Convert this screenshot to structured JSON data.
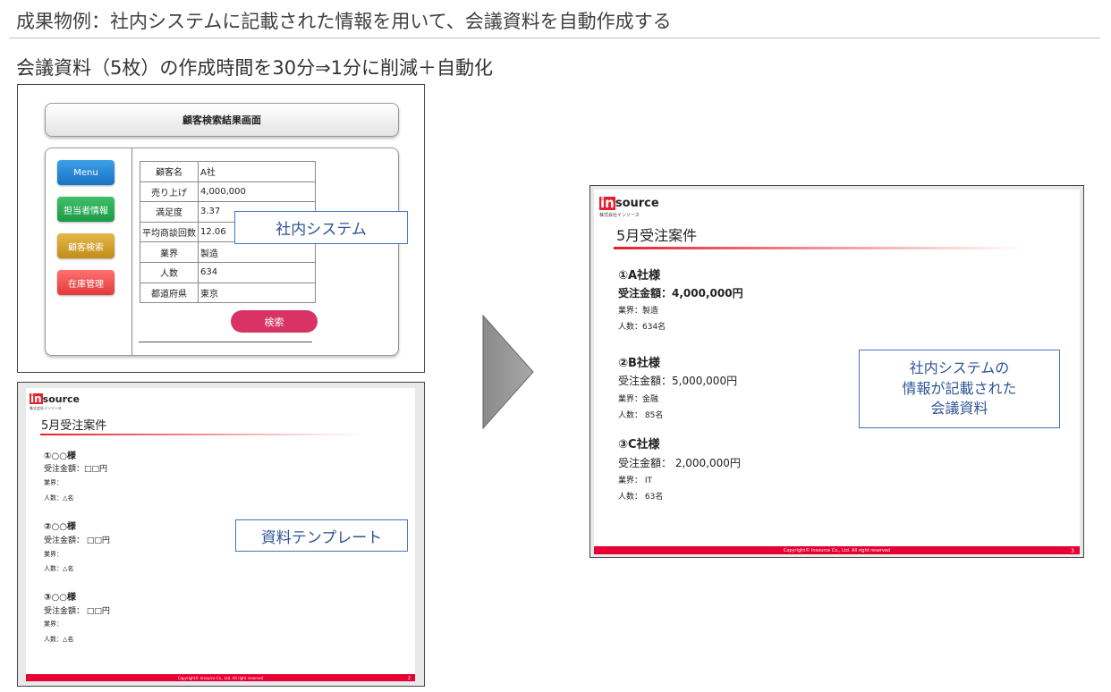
{
  "header": {
    "title": "成果物例：社内システムに記載された情報を用いて、会議資料を自動作成する",
    "subtitle": "会議資料（5枚）の作成時間を30分⇒1分に削減＋自動化"
  },
  "system": {
    "screen_title": "顧客検索結果画面",
    "menu": [
      "Menu",
      "担当者情報",
      "顧客検索",
      "在庫管理"
    ],
    "rows": [
      {
        "label": "顧客名",
        "value": "A社"
      },
      {
        "label": "売り上げ",
        "value": "4,000,000"
      },
      {
        "label": "満足度",
        "value": "3.37"
      },
      {
        "label": "平均商談回数",
        "value": "12.06"
      },
      {
        "label": "業界",
        "value": "製造"
      },
      {
        "label": "人数",
        "value": "634"
      },
      {
        "label": "都道府県",
        "value": "東京"
      }
    ],
    "search_label": "検索",
    "callout": "社内システム"
  },
  "template_slide": {
    "logo_in": "in",
    "logo_source": "source",
    "logo_sub": "株式会社インソース",
    "heading": "5月受注案件",
    "items": [
      {
        "name": "①○○様",
        "amount": "受注金額：□□円",
        "industry": "業界：",
        "people": "人数：△名"
      },
      {
        "name": "②○○様",
        "amount": "受注金額： □□円",
        "industry": "業界：",
        "people": "人数：△名"
      },
      {
        "name": "③○○様",
        "amount": "受注金額： □□円",
        "industry": "業界：",
        "people": "人数：△名"
      }
    ],
    "footer": "Copyright© Insource Co., Ltd. All right reserved",
    "page": "2",
    "callout": "資料テンプレート"
  },
  "result_slide": {
    "logo_in": "in",
    "logo_source": "source",
    "logo_sub": "株式会社インソース",
    "heading": "5月受注案件",
    "items": [
      {
        "name": "①A社様",
        "amount": "受注金額：4,000,000円",
        "industry": "業界：製造",
        "people": "人数：634名"
      },
      {
        "name": "②B社様",
        "amount": "受注金額：5,000,000円",
        "industry": "業界：金融",
        "people": "人数： 85名"
      },
      {
        "name": "③C社様",
        "amount": "受注金額： 2,000,000円",
        "industry": "業界： IT",
        "people": "人数： 63名"
      }
    ],
    "footer": "Copyright© Insource Co., Ltd. All right reserved",
    "page": "3",
    "callout_lines": [
      "社内システムの",
      "情報が記載された",
      "会議資料"
    ]
  },
  "colors": {
    "brand_red": "#e60033",
    "callout_border": "#4472c4",
    "search_button": "#d83364"
  },
  "icons": {
    "arrow": "right-triangle-arrow-icon"
  }
}
